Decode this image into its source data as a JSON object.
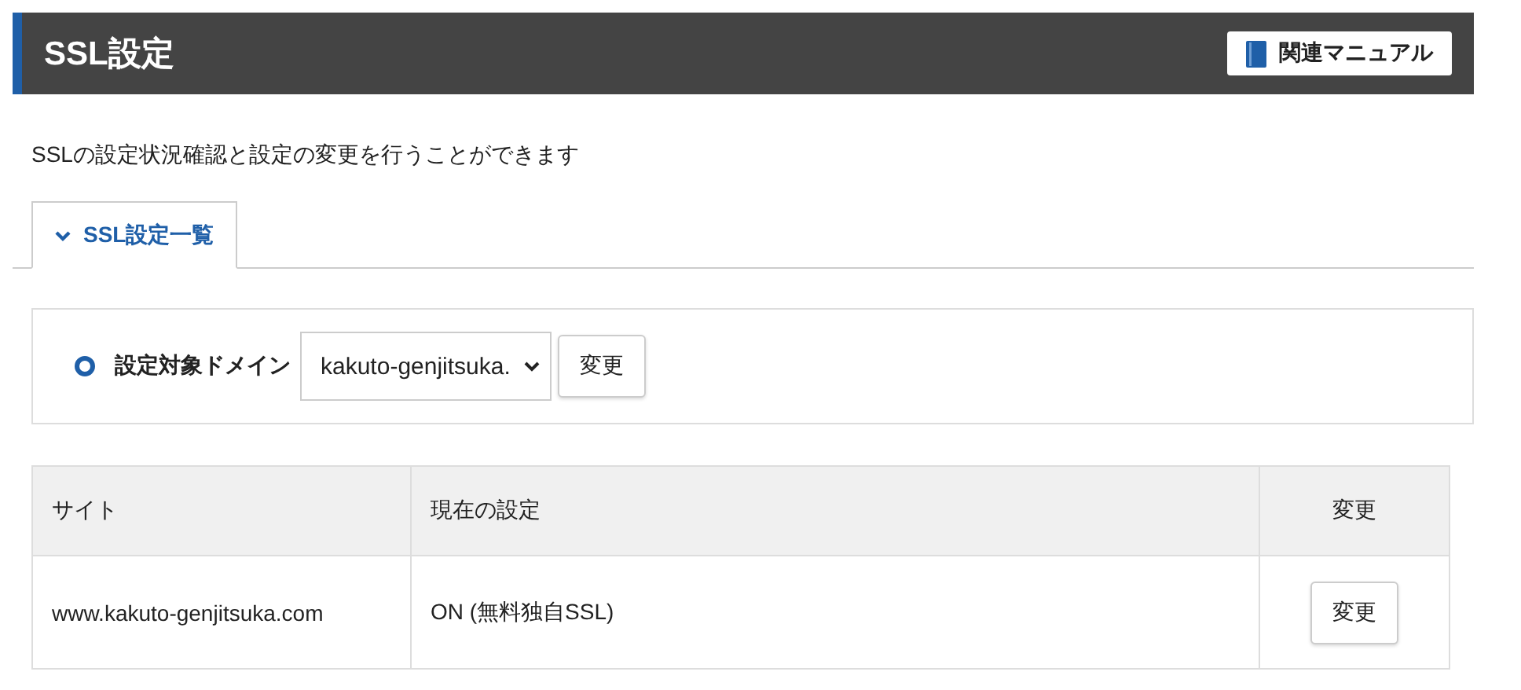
{
  "header": {
    "title": "SSL設定",
    "manual_button": "関連マニュアル"
  },
  "description": "SSLの設定状況確認と設定の変更を行うことができます",
  "tabs": [
    {
      "label": "SSL設定一覧",
      "selected": true
    }
  ],
  "domain_selector": {
    "label": "設定対象ドメイン",
    "value": "kakuto-genjitsuka.",
    "button": "変更"
  },
  "table": {
    "columns": [
      "サイト",
      "現在の設定",
      "変更"
    ],
    "rows": [
      {
        "site": "www.kakuto-genjitsuka.com",
        "setting": "ON (無料独自SSL)",
        "button": "変更"
      }
    ]
  }
}
